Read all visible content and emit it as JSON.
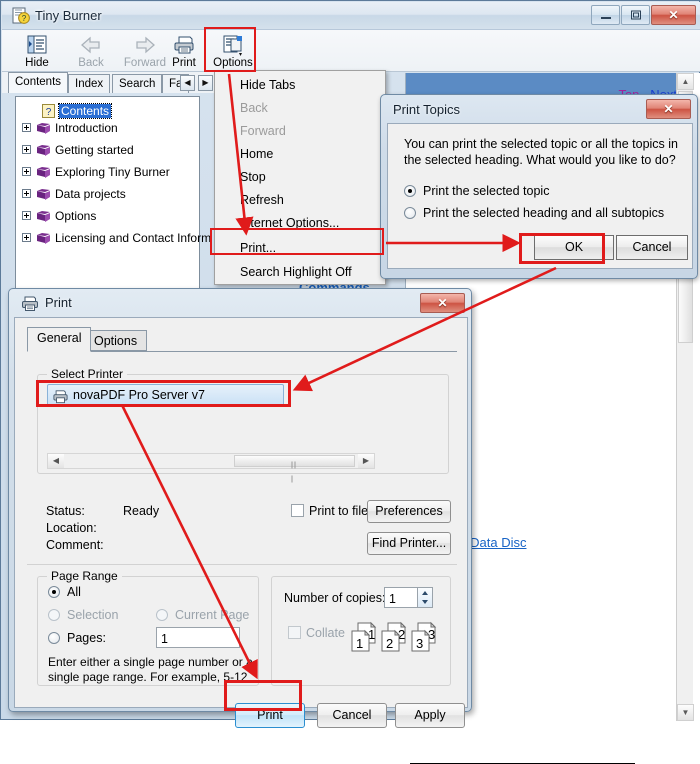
{
  "help_window": {
    "title": "Tiny Burner",
    "title_icon": "help-book-icon",
    "window_buttons": {
      "minimize": "–",
      "maximize": "□",
      "close": "✕"
    },
    "toolbar": [
      {
        "label": "Hide",
        "icon": "hide-pane-icon",
        "disabled": false,
        "accel": "H"
      },
      {
        "label": "Back",
        "icon": "back-arrow-icon",
        "disabled": true,
        "accel": "B"
      },
      {
        "label": "Forward",
        "icon": "forward-arrow-icon",
        "disabled": true,
        "accel": "F"
      },
      {
        "label": "Print",
        "icon": "printer-icon",
        "disabled": false,
        "accel": "P"
      },
      {
        "label": "Options",
        "icon": "options-icon",
        "disabled": false,
        "accel": "O"
      }
    ],
    "tabs": [
      {
        "label": "Contents",
        "selected": true
      },
      {
        "label": "Index",
        "selected": false
      },
      {
        "label": "Search",
        "selected": false
      },
      {
        "label": "Fa",
        "selected": false
      }
    ],
    "tab_scroll": {
      "left": "◀",
      "right": "▶"
    },
    "tree": [
      {
        "label": "Contents",
        "icon": "help-page-icon",
        "selected": true,
        "expandable": false
      },
      {
        "label": "Introduction",
        "icon": "book-icon",
        "selected": false,
        "expandable": true
      },
      {
        "label": "Getting started",
        "icon": "book-icon",
        "selected": false,
        "expandable": true
      },
      {
        "label": "Exploring Tiny Burner",
        "icon": "book-icon",
        "selected": false,
        "expandable": true
      },
      {
        "label": "Data projects",
        "icon": "book-icon",
        "selected": false,
        "expandable": true
      },
      {
        "label": "Options",
        "icon": "book-icon",
        "selected": false,
        "expandable": true
      },
      {
        "label": "Licensing and Contact Inform",
        "icon": "book-icon",
        "selected": false,
        "expandable": true
      }
    ],
    "content": {
      "top_link": "Top",
      "next_link": "Next",
      "heading": "Commands",
      "body_link": "ers from a Data Disc",
      "scroll_up": "▲",
      "scroll_down": "▼"
    }
  },
  "options_menu": {
    "items": [
      {
        "label": "Hide Tabs",
        "disabled": false
      },
      {
        "label": "Back",
        "disabled": true
      },
      {
        "label": "Forward",
        "disabled": true
      },
      {
        "label": "Home",
        "disabled": false
      },
      {
        "label": "Stop",
        "disabled": false
      },
      {
        "label": "Refresh",
        "disabled": false
      },
      {
        "label": "Internet Options...",
        "disabled": false
      },
      {
        "label": "Print...",
        "disabled": false
      },
      {
        "label": "Search Highlight Off",
        "disabled": false
      }
    ]
  },
  "print_topics_dialog": {
    "title": "Print Topics",
    "close_glyph": "✕",
    "message": "You can print the selected topic or all the topics in the selected heading. What would you like to do?",
    "options": [
      {
        "label": "Print the selected topic",
        "selected": true
      },
      {
        "label": "Print the selected heading and all subtopics",
        "selected": false
      }
    ],
    "buttons": {
      "ok": "OK",
      "cancel": "Cancel"
    }
  },
  "print_dialog": {
    "title": "Print",
    "title_icon": "printer-icon",
    "close_glyph": "✕",
    "tabs": [
      {
        "label": "General",
        "selected": true
      },
      {
        "label": "Options",
        "selected": false
      }
    ],
    "select_printer": {
      "group_label": "Select Printer",
      "printers": [
        {
          "name": "novaPDF Pro Server v7",
          "icon": "printer-icon",
          "selected": true
        }
      ],
      "scroll_left": "◀",
      "scroll_right": "▶"
    },
    "printer_info": {
      "status_label": "Status:",
      "status_value": "Ready",
      "location_label": "Location:",
      "location_value": "",
      "comment_label": "Comment:",
      "comment_value": "",
      "print_to_file_label": "Print to file",
      "print_to_file_checked": false,
      "preferences_button": "Preferences",
      "find_printer_button": "Find Printer..."
    },
    "page_range": {
      "group_label": "Page Range",
      "options": [
        {
          "label": "All",
          "selected": true,
          "disabled": false
        },
        {
          "label": "Selection",
          "selected": false,
          "disabled": true
        },
        {
          "label": "Current Page",
          "selected": false,
          "disabled": true
        },
        {
          "label": "Pages:",
          "selected": false,
          "disabled": false
        }
      ],
      "pages_value": "1",
      "hint": "Enter either a single page number or a single page range.  For example, 5-12"
    },
    "copies": {
      "label": "Number of copies:",
      "value": "1",
      "spin_up": "▲",
      "spin_down": "▼",
      "collate_label": "Collate",
      "collate_checked": false,
      "collate_preview_pages": [
        "1",
        "2",
        "3"
      ]
    },
    "buttons": {
      "print": "Print",
      "cancel": "Cancel",
      "apply": "Apply"
    }
  },
  "annotations": {
    "highlight_color": "#e01b1b",
    "highlights": [
      {
        "target": "options-toolbar-button"
      },
      {
        "target": "print-menu-item"
      },
      {
        "target": "ok-button"
      },
      {
        "target": "printer-list-item"
      },
      {
        "target": "print-button"
      }
    ],
    "arrows": [
      {
        "from": "options-toolbar-button",
        "to": "print-menu-item"
      },
      {
        "from": "print-menu-item",
        "to": "ok-button"
      },
      {
        "from": "ok-button",
        "to": "printer-list-item"
      },
      {
        "from": "printer-list-item",
        "to": "print-button"
      }
    ]
  }
}
